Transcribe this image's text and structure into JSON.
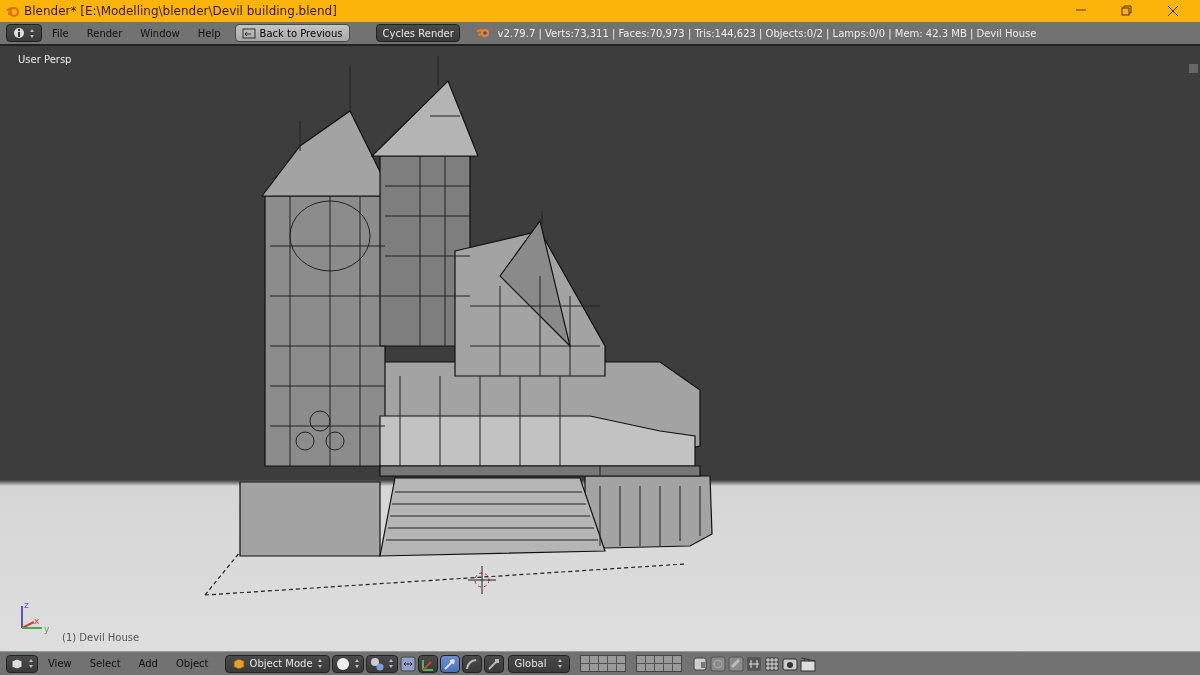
{
  "window": {
    "title": "Blender* [E:\\Modelling\\blender\\Devil building.blend]"
  },
  "info_header": {
    "menus": [
      "File",
      "Render",
      "Window",
      "Help"
    ],
    "back_button": "Back to Previous",
    "render_engine": "Cycles Render",
    "stats": "v2.79.7 | Verts:73,311 | Faces:70,973 | Tris:144,623 | Objects:0/2 | Lamps:0/0 | Mem: 42.3 MB | Devil House"
  },
  "viewport": {
    "view_label": "User Persp",
    "object_label": "(1) Devil House",
    "axis_labels": [
      "z",
      "x",
      "y"
    ]
  },
  "view3d_header": {
    "menus": [
      "View",
      "Select",
      "Add",
      "Object"
    ],
    "mode": "Object Mode",
    "manipulators": [
      {
        "kind": "toggle",
        "selected": false
      },
      {
        "kind": "translate",
        "selected": true
      },
      {
        "kind": "rotate",
        "selected": false
      },
      {
        "kind": "scale",
        "selected": false
      }
    ],
    "orientation": "Global"
  }
}
